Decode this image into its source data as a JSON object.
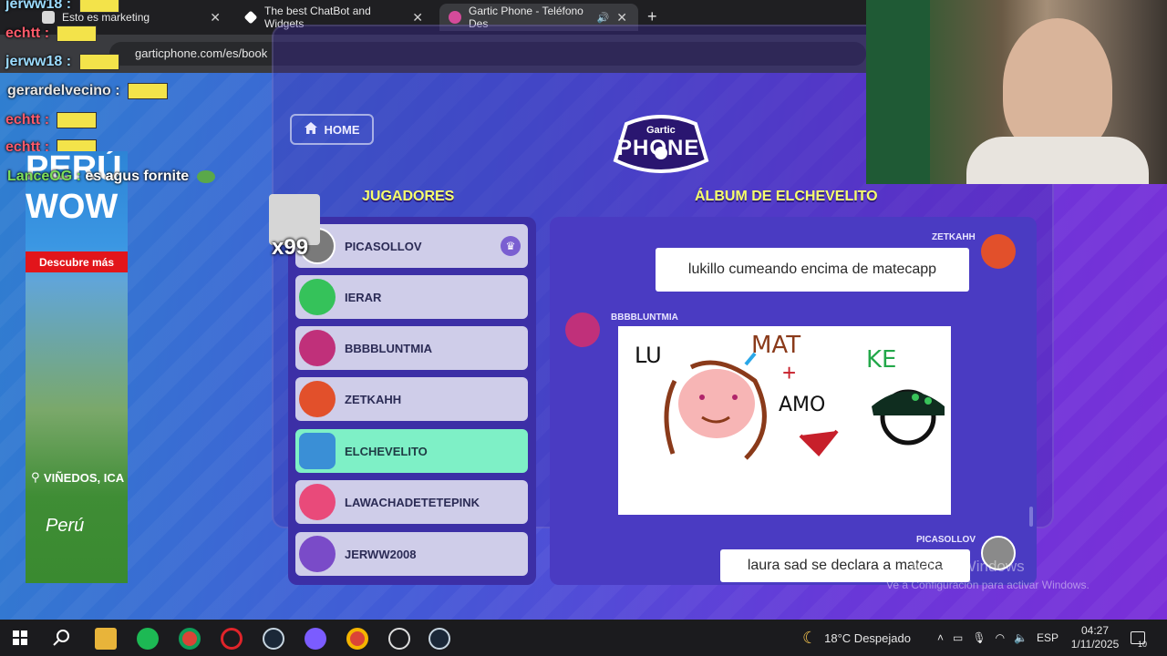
{
  "browser": {
    "tabs": [
      {
        "title": "Esto es marketing",
        "close": "✕"
      },
      {
        "title": "The best ChatBot and Widgets",
        "close": "✕"
      },
      {
        "title": "Gartic Phone - Teléfono Des",
        "close": "✕"
      }
    ],
    "new_tab": "+",
    "url": "garticphone.com/es/book"
  },
  "game": {
    "home_label": "HOME",
    "logo_top": "Gartic",
    "logo_bottom": "PHONE",
    "players_title": "JUGADORES",
    "album_title": "ÁLBUM DE ELCHEVELITO",
    "players": [
      {
        "name": "PICASOLLOV"
      },
      {
        "name": "IERAR"
      },
      {
        "name": "BBBBLUNTMIA"
      },
      {
        "name": "ZETKAHH"
      },
      {
        "name": "ELCHEVELITO"
      },
      {
        "name": "LAWACHADETETEPINK"
      },
      {
        "name": "JERWW2008"
      }
    ],
    "badge_count": "x99",
    "messages": [
      {
        "author": "ZETKAHH",
        "text": "lukillo cumeando encima de matecapp"
      },
      {
        "author": "BBBBLUNTMIA"
      },
      {
        "author": "PICASOLLOV",
        "text": "laura sad se declara a mateca"
      }
    ],
    "drawing_text": {
      "lu": "LU",
      "mat": "MAT",
      "plus": "+",
      "amo": "AMO",
      "ke": "KE"
    }
  },
  "overlay": {
    "chat": [
      {
        "user": "jerww18",
        "sep": ":"
      },
      {
        "user": "echtt",
        "sep": ":"
      },
      {
        "user": "jerww18",
        "sep": ":"
      },
      {
        "user": "gerardelvecino",
        "sep": ":"
      },
      {
        "user": "echtt",
        "sep": ":"
      },
      {
        "user": "echtt",
        "sep": ":"
      },
      {
        "user": "LanceOG",
        "sep": ":",
        "text": "es agus fornite"
      }
    ],
    "ad": {
      "headline_1": "PERÚ",
      "headline_2": "WOW",
      "cta": "Descubre más",
      "location": "VIÑEDOS, ICA",
      "brand": "Perú"
    },
    "watermark_1": "Activar Windows",
    "watermark_2": "Ve a Configuración para activar Windows."
  },
  "taskbar": {
    "weather": "18°C  Despejado",
    "lang": "ESP",
    "time": "04:27",
    "date": "1/11/2025",
    "notifications": "10"
  }
}
